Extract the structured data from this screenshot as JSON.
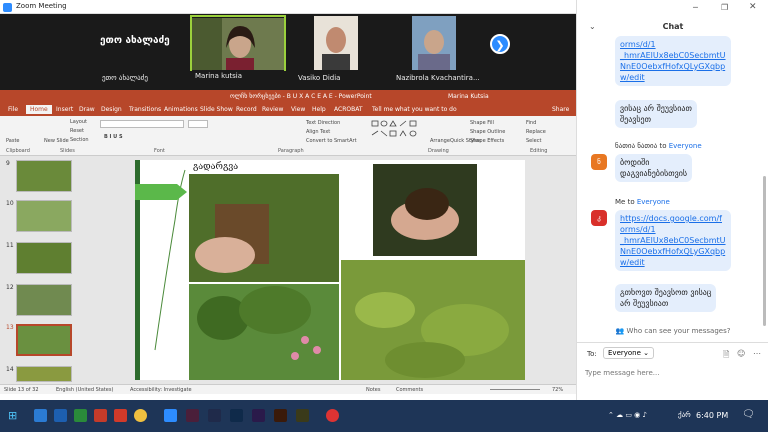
{
  "window": {
    "title": "Zoom Meeting"
  },
  "participants": [
    {
      "name": "ეთო ახალაძე",
      "big_label": "ეთო ახალაძე",
      "muted": true
    },
    {
      "name": "Marina kutsia",
      "muted": false
    },
    {
      "name": "Vasiko Didia",
      "muted": true
    },
    {
      "name": "Nazibrola Kvachantira...",
      "muted": true
    }
  ],
  "ppt": {
    "title": "ოლჩხ ხორცხეები - B U X A C E A E - PowerPoint",
    "user": "Marina Kutsia",
    "tabs": [
      "File",
      "Home",
      "Insert",
      "Draw",
      "Design",
      "Transitions",
      "Animations",
      "Slide Show",
      "Record",
      "Review",
      "View",
      "Help",
      "ACROBAT",
      "Tell me what you want to do",
      "Share"
    ],
    "groups": [
      "Clipboard",
      "Slides",
      "Font",
      "Paragraph",
      "Drawing",
      "Editing"
    ],
    "ribbon_buttons": {
      "paste": "Paste",
      "new_slide": "New Slide",
      "layout": "Layout",
      "reset": "Reset",
      "section": "Section",
      "text_direction": "Text Direction",
      "align_text": "Align Text",
      "convert": "Convert to SmartArt",
      "arrange": "Arrange",
      "quick_styles": "Quick Styles",
      "shape_fill": "Shape Fill",
      "shape_outline": "Shape Outline",
      "shape_effects": "Shape Effects",
      "find": "Find",
      "replace": "Replace",
      "select": "Select"
    },
    "slide_numbers": [
      "9",
      "10",
      "11",
      "12",
      "13",
      "14"
    ],
    "slide_heading": "გადარგვა",
    "status": {
      "slide": "Slide 13 of 32",
      "language": "English (United States)",
      "accessibility": "Accessibility: Investigate",
      "notes": "Notes",
      "comments": "Comments",
      "zoom": "72%"
    }
  },
  "chat": {
    "title": "Chat",
    "messages": [
      {
        "type": "link",
        "text": "orms/d/1\n_hmrAElUx8ebC0SecbmtU\nNnE0OebxfHofxQLyGXqbp\nw/edit"
      },
      {
        "type": "text",
        "text": "ვისაც არ შეუვსიათ\nშეავსეთ"
      },
      {
        "type": "sender",
        "from": "ნათია ნათია",
        "to_word": "to",
        "to": "Everyone",
        "avatar": "ნ"
      },
      {
        "type": "text",
        "text": "ბოდიში\nდაგვიანებისთვის"
      },
      {
        "type": "sender",
        "from": "Me",
        "to_word": "to",
        "to": "Everyone",
        "avatar": "კ"
      },
      {
        "type": "link",
        "text": "https://docs.google.com/f\norms/d/1\n_hmrAElUx8ebC0SecbmtU\nNnE0OebxfHofxQLyGXqbp\nw/edit"
      },
      {
        "type": "text",
        "text": "გთხოვთ შეავსოთ ვისაც\nარ შეუვსიათ"
      }
    ],
    "who_can_see": "Who can see your messages?",
    "to_label": "To:",
    "recipient": "Everyone",
    "input_placeholder": "Type message here..."
  },
  "taskbar": {
    "time": "6:40 PM",
    "lang": "ქარ"
  },
  "colors": {
    "ppt_accent": "#b7472a",
    "zoom_blue": "#2d8cff",
    "taskbar": "#1e3557",
    "speaker_border": "#9bd13c"
  }
}
